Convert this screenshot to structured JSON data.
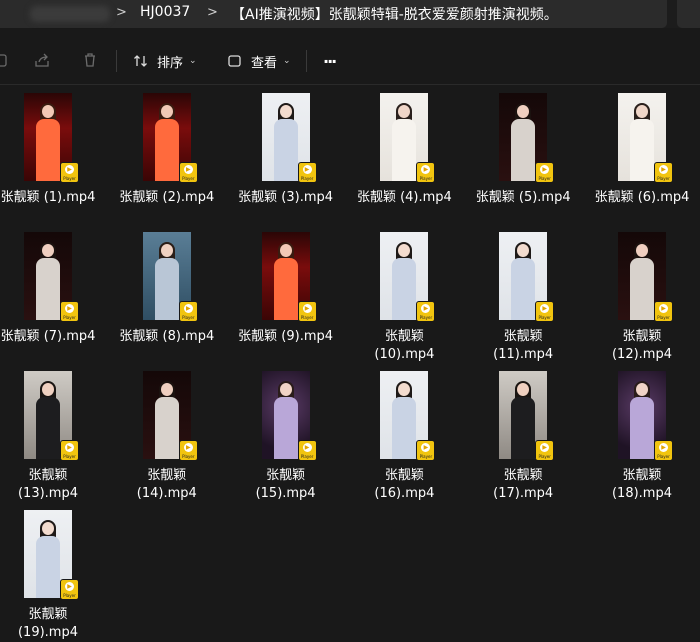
{
  "address": {
    "crumbs": [
      "HJ0037",
      "【AI推演视频】张靓颖特辑-脱衣爱爱颜射推演视频。"
    ]
  },
  "toolbar": {
    "sort_label": "排序",
    "view_label": "查看",
    "more_label": "···"
  },
  "badge_text": "Player",
  "files": [
    {
      "name": "张靓颖 (1).mp4",
      "theme": "red"
    },
    {
      "name": "张靓颖 (2).mp4",
      "theme": "red"
    },
    {
      "name": "张靓颖 (3).mp4",
      "theme": "white"
    },
    {
      "name": "张靓颖 (4).mp4",
      "theme": "cream"
    },
    {
      "name": "张靓颖 (5).mp4",
      "theme": "dark"
    },
    {
      "name": "张靓颖 (6).mp4",
      "theme": "cream"
    },
    {
      "name": "张靓颖 (7).mp4",
      "theme": "dark"
    },
    {
      "name": "张靓颖 (8).mp4",
      "theme": "blue"
    },
    {
      "name": "张靓颖 (9).mp4",
      "theme": "red"
    },
    {
      "name": "张靓颖\n(10).mp4",
      "theme": "white"
    },
    {
      "name": "张靓颖\n(11).mp4",
      "theme": "white"
    },
    {
      "name": "张靓颖\n(12).mp4",
      "theme": "dark"
    },
    {
      "name": "张靓颖\n(13).mp4",
      "theme": "grey"
    },
    {
      "name": "张靓颖\n(14).mp4",
      "theme": "dark"
    },
    {
      "name": "张靓颖\n(15).mp4",
      "theme": "purple"
    },
    {
      "name": "张靓颖\n(16).mp4",
      "theme": "white"
    },
    {
      "name": "张靓颖\n(17).mp4",
      "theme": "grey"
    },
    {
      "name": "张靓颖\n(18).mp4",
      "theme": "purple"
    },
    {
      "name": "张靓颖\n(19).mp4",
      "theme": "white"
    }
  ],
  "colors": {
    "background": "#191919",
    "badge": "#f1c40f",
    "text": "#ffffff"
  }
}
